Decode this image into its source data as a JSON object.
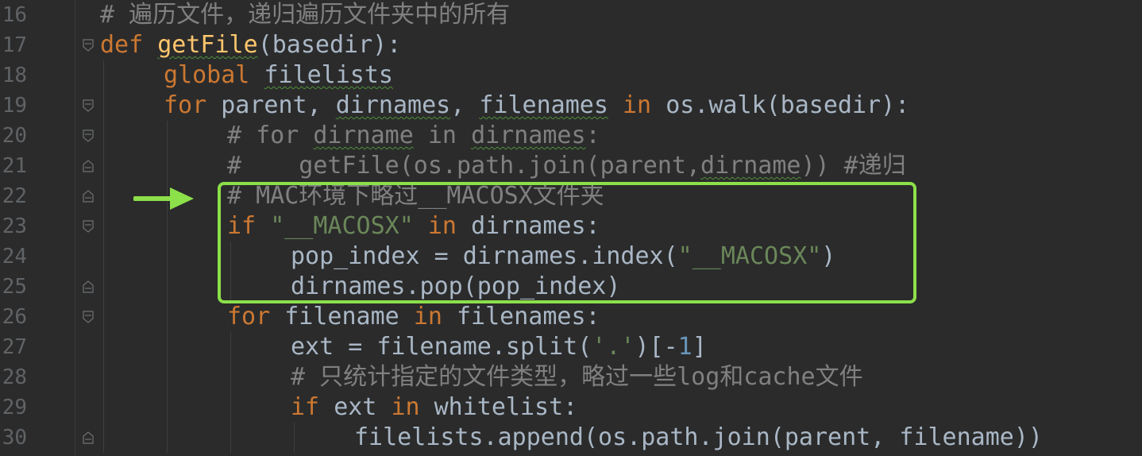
{
  "editor": {
    "line_numbers": [
      "16",
      "17",
      "18",
      "19",
      "20",
      "21",
      "22",
      "23",
      "24",
      "25",
      "26",
      "27",
      "28",
      "29",
      "30"
    ],
    "lines": [
      {
        "num": "16",
        "indent": 0,
        "tokens": [
          {
            "t": "# 遍历文件，递归遍历文件夹中的所有",
            "c": "cm"
          }
        ]
      },
      {
        "num": "17",
        "indent": 0,
        "tokens": [
          {
            "t": "def ",
            "c": "kw"
          },
          {
            "t": "getFile",
            "c": "fn",
            "sq": true
          },
          {
            "t": "(basedir):",
            "c": ""
          }
        ]
      },
      {
        "num": "18",
        "indent": 1,
        "tokens": [
          {
            "t": "global ",
            "c": "kw"
          },
          {
            "t": "filelists",
            "c": "",
            "sq": true
          }
        ]
      },
      {
        "num": "19",
        "indent": 1,
        "tokens": [
          {
            "t": "for ",
            "c": "kw"
          },
          {
            "t": "parent, ",
            "c": ""
          },
          {
            "t": "dirnames",
            "c": "",
            "sq": true
          },
          {
            "t": ", ",
            "c": ""
          },
          {
            "t": "filenames",
            "c": "",
            "sq": true
          },
          {
            "t": " in ",
            "c": "kw"
          },
          {
            "t": "os.walk(basedir):",
            "c": ""
          }
        ]
      },
      {
        "num": "20",
        "indent": 2,
        "tokens": [
          {
            "t": "# for ",
            "c": "cm"
          },
          {
            "t": "dirname",
            "c": "cm",
            "sq": true
          },
          {
            "t": " in ",
            "c": "cm"
          },
          {
            "t": "dirnames",
            "c": "cm",
            "sq": true
          },
          {
            "t": ":",
            "c": "cm"
          }
        ]
      },
      {
        "num": "21",
        "indent": 2,
        "tokens": [
          {
            "t": "#    getFile(os.path.join(parent,",
            "c": "cm"
          },
          {
            "t": "dirname",
            "c": "cm",
            "sq": true
          },
          {
            "t": ")) #递归",
            "c": "cm"
          }
        ]
      },
      {
        "num": "22",
        "indent": 2,
        "tokens": [
          {
            "t": "# MAC环境下略过__MACOSX文件夹",
            "c": "cm"
          }
        ]
      },
      {
        "num": "23",
        "indent": 2,
        "tokens": [
          {
            "t": "if ",
            "c": "kw"
          },
          {
            "t": "\"__MACOSX\"",
            "c": "str"
          },
          {
            "t": " in ",
            "c": "kw"
          },
          {
            "t": "dirnames:",
            "c": ""
          }
        ]
      },
      {
        "num": "24",
        "indent": 3,
        "tokens": [
          {
            "t": "pop_index = dirnames.index(",
            "c": ""
          },
          {
            "t": "\"__MACOSX\"",
            "c": "str"
          },
          {
            "t": ")",
            "c": ""
          }
        ]
      },
      {
        "num": "25",
        "indent": 3,
        "tokens": [
          {
            "t": "dirnames.pop(pop_index)",
            "c": ""
          }
        ]
      },
      {
        "num": "26",
        "indent": 2,
        "tokens": [
          {
            "t": "for ",
            "c": "kw"
          },
          {
            "t": "filename ",
            "c": ""
          },
          {
            "t": "in ",
            "c": "kw"
          },
          {
            "t": "filenames:",
            "c": ""
          }
        ]
      },
      {
        "num": "27",
        "indent": 3,
        "tokens": [
          {
            "t": "ext = filename.split(",
            "c": ""
          },
          {
            "t": "'.'",
            "c": "str"
          },
          {
            "t": ")[-",
            "c": ""
          },
          {
            "t": "1",
            "c": "num"
          },
          {
            "t": "]",
            "c": ""
          }
        ]
      },
      {
        "num": "28",
        "indent": 3,
        "tokens": [
          {
            "t": "# 只统计指定的文件类型，略过一些log和cache文件",
            "c": "cm"
          }
        ]
      },
      {
        "num": "29",
        "indent": 3,
        "tokens": [
          {
            "t": "if ",
            "c": "kw"
          },
          {
            "t": "ext ",
            "c": ""
          },
          {
            "t": "in ",
            "c": "kw"
          },
          {
            "t": "whitelist:",
            "c": ""
          }
        ]
      },
      {
        "num": "30",
        "indent": 4,
        "tokens": [
          {
            "t": "filelists.append(os.path.join(parent, filename))",
            "c": ""
          }
        ]
      }
    ],
    "fold_markers": {
      "17": "open",
      "19": "open",
      "20": "open",
      "21": "close",
      "22": "close",
      "23": "open",
      "25": "close",
      "26": "open",
      "30": "close"
    },
    "colors": {
      "background": "#2b2b2b",
      "keyword": "#cc7832",
      "function": "#ffc66d",
      "string": "#6a8759",
      "number": "#6897bb",
      "comment": "#808080",
      "text": "#a9b7c6",
      "annotation": "#8ce04a"
    }
  },
  "annotation": {
    "arrow_icon": "right-arrow-icon",
    "box": "highlight-box"
  }
}
